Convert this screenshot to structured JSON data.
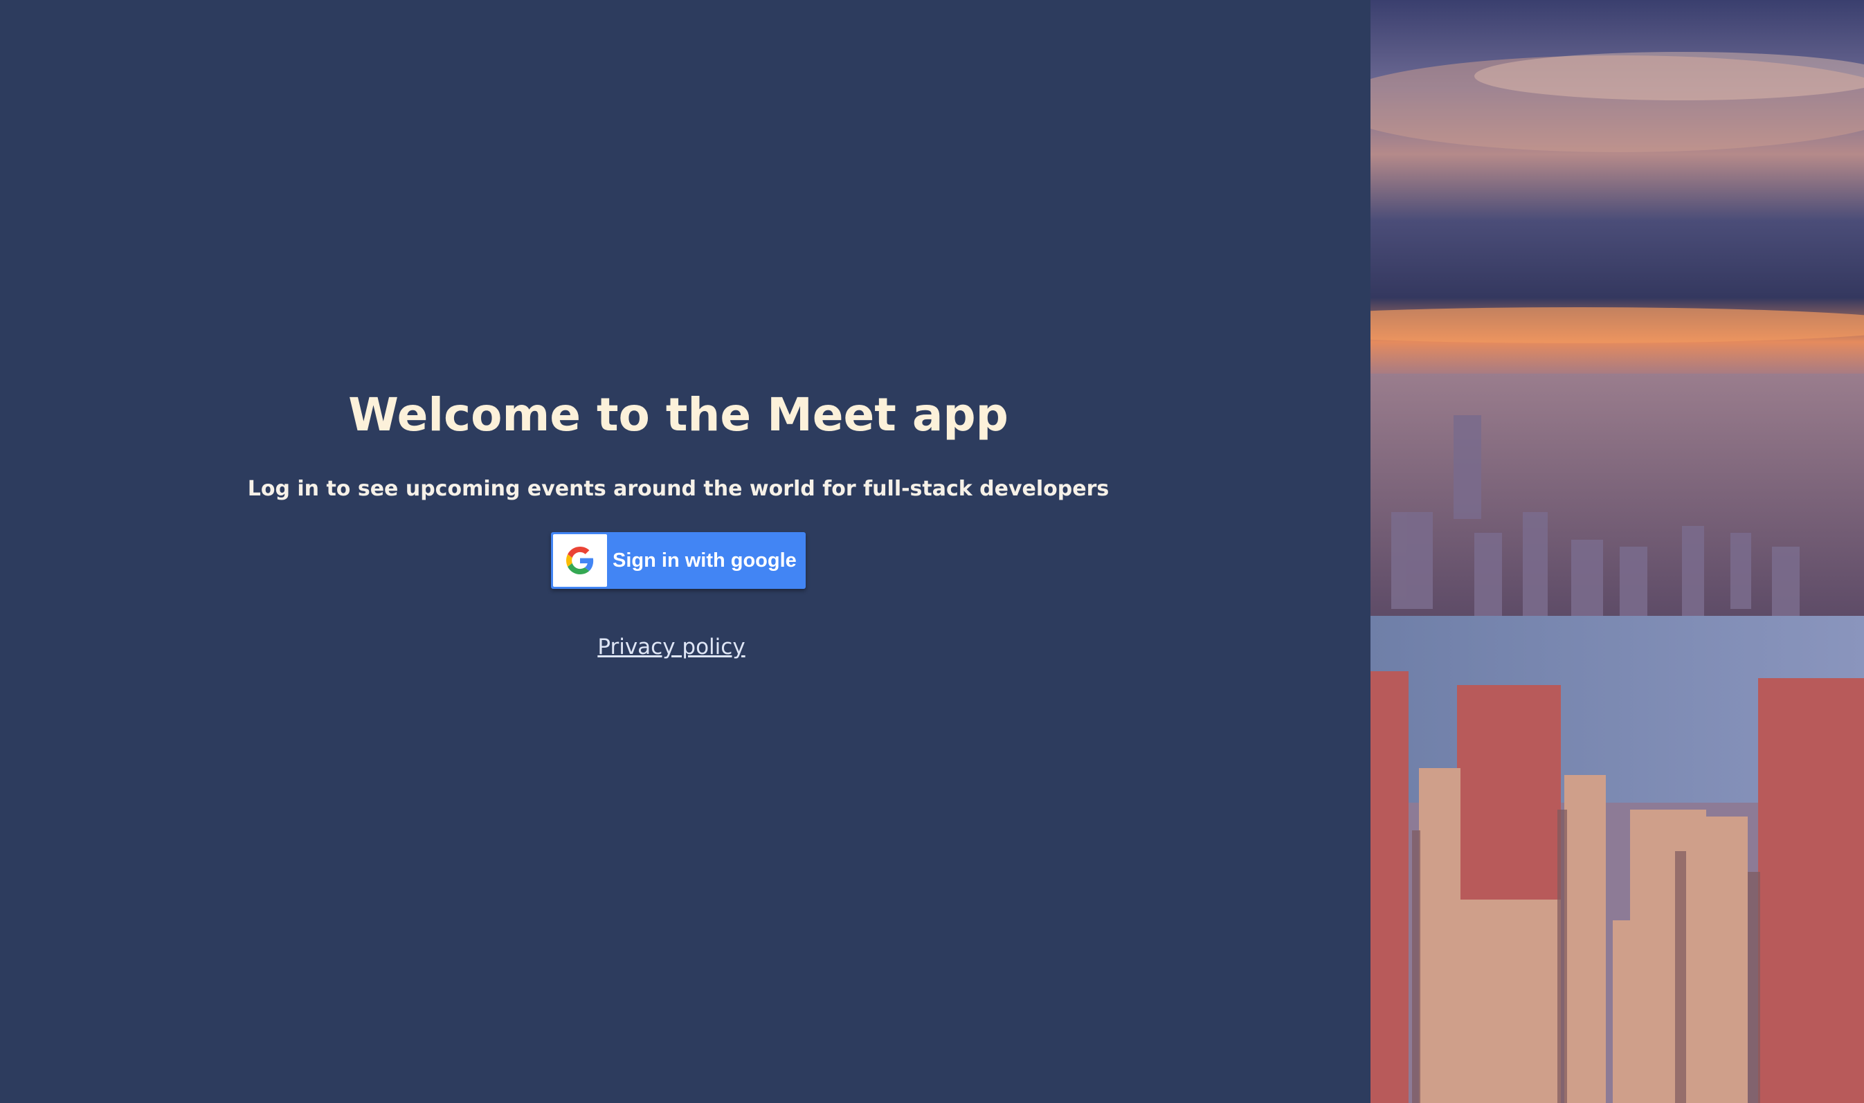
{
  "login": {
    "title": "Welcome to the Meet app",
    "subtitle": "Log in to see upcoming events around the world for full-stack developers",
    "google_button_label": "Sign in with google",
    "google_icon": "google-g-icon",
    "privacy_link": "Privacy policy"
  },
  "colors": {
    "background": "#2d3c5e",
    "title_text": "#fcf1da",
    "google_blue": "#4285f4",
    "link_text": "#dfe6f6"
  },
  "hero": {
    "image": "city-skyline-photo"
  }
}
